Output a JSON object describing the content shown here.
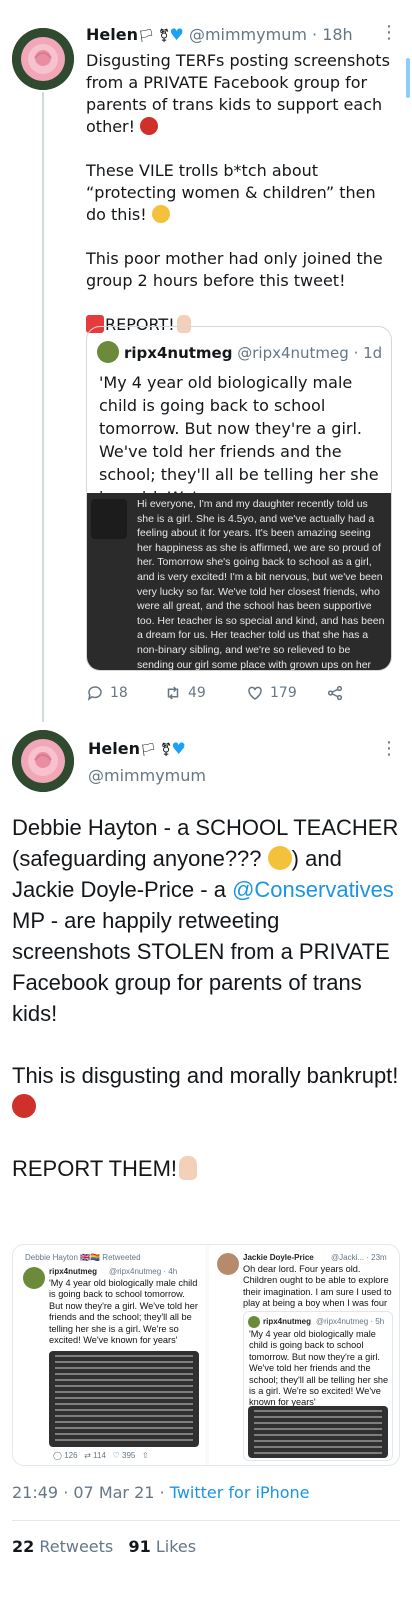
{
  "tweet1": {
    "name": "Helen",
    "badges": "🏳️‍⚧️",
    "handle": "@mimmymum",
    "time": "· 18h",
    "text_p1": "Disgusting TERFs posting screenshots from a PRIVATE Facebook group for parents of trans kids to support each other! ",
    "text_p2": "These VILE trolls b*tch about “protecting women & children” then do this! ",
    "text_p3": "This poor mother had only joined the group 2 hours before this tweet!",
    "text_p4": "REPORT!",
    "quote": {
      "name": "ripx4nutmeg",
      "handle": "@ripx4nutmeg",
      "time": "· 1d",
      "text": "'My 4 year old biologically male child is going back to school tomorrow. But now they're a girl. We've told her friends and the school; they'll all be telling her she is a girl. We're so exc...",
      "screenshot_text": "Hi everyone, I'm          and my daughter recently told us she is a girl. She is 4.5yo, and we've actually had a feeling about it for years. It's been amazing seeing her happiness as she is affirmed, we are so proud of her. Tomorrow she's going back to school as a girl, and is very excited! I'm a bit nervous, but we've been very lucky so far. We've told her closest friends, who were all great, and the school has been supportive too. Her teacher is so special and kind, and has been a dream for us. Her teacher told us that she has a non-binary sibling, and we're so relieved to be sending our girl some place with grown ups on her side. Does anyone else have a child coming out at school tomorrow?"
    },
    "replies": "18",
    "retweets": "49",
    "likes": "179"
  },
  "tweet2": {
    "name": "Helen",
    "handle": "@mimmymum",
    "text_a": "Debbie Hayton - a SCHOOL TEACHER (safeguarding anyone??? ",
    "text_b": ") and Jackie Doyle-Price - a ",
    "mention": "@Conservatives",
    "text_c": " MP - are happily retweeting screenshots STOLEN from a PRIVATE Facebook group for parents of trans kids!",
    "text_p2": "This is disgusting and morally bankrupt! ",
    "text_p3": "REPORT THEM!",
    "media": {
      "left": {
        "retweeted_by": "Debbie Hayton 🇬🇧🏳️‍🌈 Retweeted",
        "name": "ripx4nutmeg",
        "handle": "@ripx4nutmeg · 4h",
        "text": "'My 4 year old biologically male child is going back to school tomorrow. But now they're a girl. We've told her friends and the school; they'll all be telling her she is a girl. We're so excited! We've known for years'",
        "replies": "126",
        "retweets": "114",
        "likes": "395"
      },
      "right": {
        "name": "Jackie Doyle-Price",
        "handle": "@Jacki... · 23m",
        "text": "Oh dear lord. Four years old. Children ought to be able to explore their imagination. I am sure I used to play at being a boy when I was four",
        "quote_name": "ripx4nutmeg",
        "quote_handle": "@ripx4nutmeg · 5h",
        "quote_text": "'My 4 year old biologically male child is going back to school tomorrow. But now they're a girl. We've told her friends and the school; they'll all be telling her she is a girl. We're so excited! We've known for years'"
      }
    },
    "timestamp": "21:49 · 07 Mar 21 · ",
    "source": "Twitter for iPhone",
    "retweet_count": "22",
    "retweet_label": " Retweets",
    "like_count": "91",
    "like_label": " Likes"
  }
}
